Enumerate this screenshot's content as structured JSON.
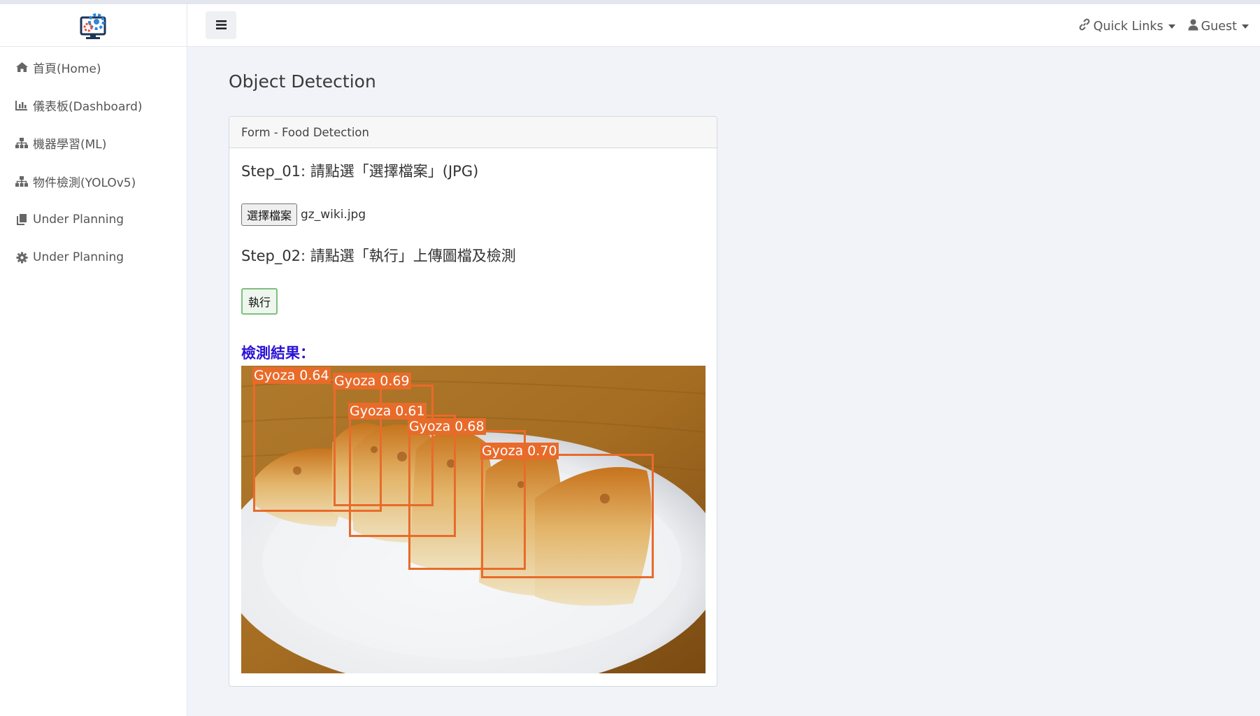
{
  "sidebar": {
    "logo_icon": "gear-monitor-logo",
    "items": [
      {
        "label": "首頁(Home)",
        "icon": "home-icon"
      },
      {
        "label": "儀表板(Dashboard)",
        "icon": "bar-chart-icon"
      },
      {
        "label": "機器學習(ML)",
        "icon": "sitemap-icon"
      },
      {
        "label": "物件檢測(YOLOv5)",
        "icon": "sitemap-icon"
      },
      {
        "label": "Under Planning",
        "icon": "copy-icon"
      },
      {
        "label": "Under Planning",
        "icon": "gear-icon"
      }
    ]
  },
  "topbar": {
    "menu_icon": "hamburger-icon",
    "quick_links": "Quick Links",
    "user": "Guest"
  },
  "main": {
    "title": "Object Detection",
    "card": {
      "header": "Form - Food Detection",
      "step1": "Step_01: 請點選「選擇檔案」(JPG)",
      "file_button": "選擇檔案",
      "file_name": "gz_wiki.jpg",
      "step2": "Step_02: 請點選「執行」上傳圖檔及檢測",
      "run_button": "執行",
      "result_title": "檢測結果：",
      "detections": [
        {
          "label": "Gyoza 0.64"
        },
        {
          "label": "Gyoza 0.69"
        },
        {
          "label": "Gyoza 0.61"
        },
        {
          "label": "Gyoza 0.68"
        },
        {
          "label": "Gyoza 0.70"
        }
      ]
    }
  },
  "colors": {
    "accent_result": "#2a13d6",
    "bbox": "#e86b2a",
    "run_border": "#7fbf7f"
  }
}
